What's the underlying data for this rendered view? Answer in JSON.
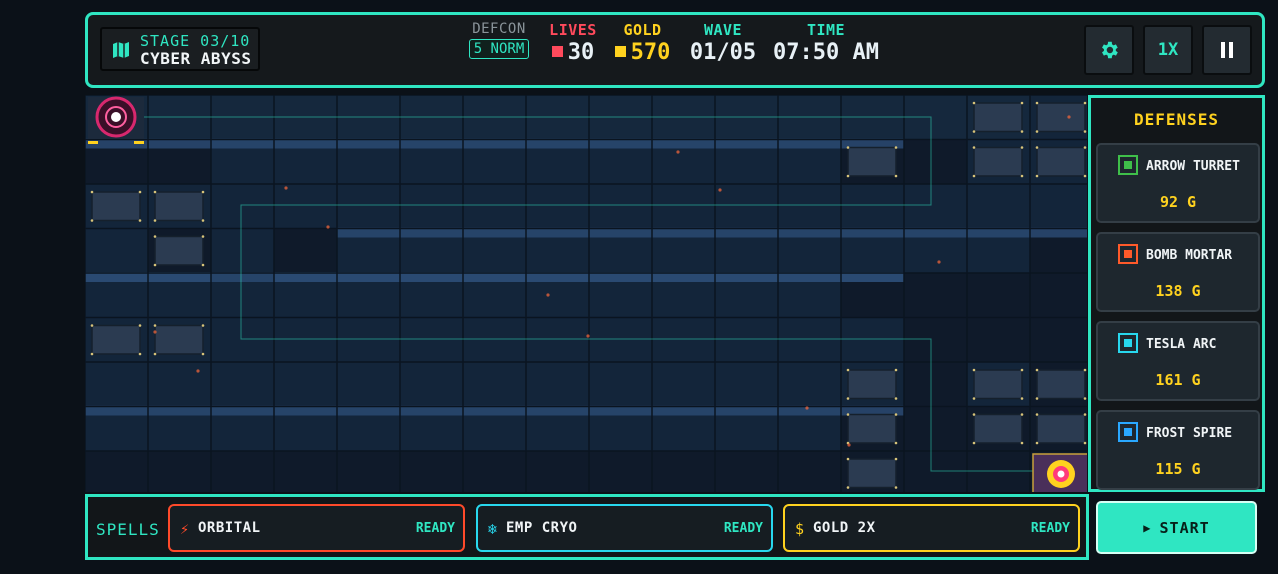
{
  "stage": {
    "number": "STAGE 03/10",
    "name": "CYBER ABYSS",
    "icon": "map-icon"
  },
  "stats": {
    "defcon": {
      "label": "DEFCON",
      "value": "5 NORM"
    },
    "lives": {
      "label": "LIVES",
      "value": "30",
      "color": "#ff4a5c"
    },
    "gold": {
      "label": "GOLD",
      "value": "570",
      "color": "#ffd21f"
    },
    "wave": {
      "label": "WAVE",
      "value": "01/05"
    },
    "time": {
      "label": "TIME",
      "value": "07:50 AM"
    }
  },
  "controls": {
    "settings_icon": "gear-icon",
    "speed_label": "1X",
    "pause_icon": "pause-icon"
  },
  "defenses": {
    "title": "DEFENSES",
    "items": [
      {
        "name": "ARROW TURRET",
        "cost": "92 G",
        "color": "#3fbf4a"
      },
      {
        "name": "BOMB MORTAR",
        "cost": "138 G",
        "color": "#ff5a2a"
      },
      {
        "name": "TESLA ARC",
        "cost": "161 G",
        "color": "#28d8ee"
      },
      {
        "name": "FROST SPIRE",
        "cost": "115 G",
        "color": "#2aa8ff"
      }
    ]
  },
  "spells": {
    "label": "SPELLS",
    "items": [
      {
        "name": "ORBITAL",
        "status": "READY",
        "icon": "lightning-icon",
        "color": "#ff4a2a"
      },
      {
        "name": "EMP CRYO",
        "status": "READY",
        "icon": "snowflake-icon",
        "color": "#28d8ee"
      },
      {
        "name": "GOLD 2X",
        "status": "READY",
        "icon": "dollar-icon",
        "color": "#ffd21f"
      }
    ]
  },
  "start": {
    "label": "START"
  },
  "colors": {
    "accent": "#2fe6c2",
    "background": "#0b1118",
    "grid": "#13253a"
  }
}
